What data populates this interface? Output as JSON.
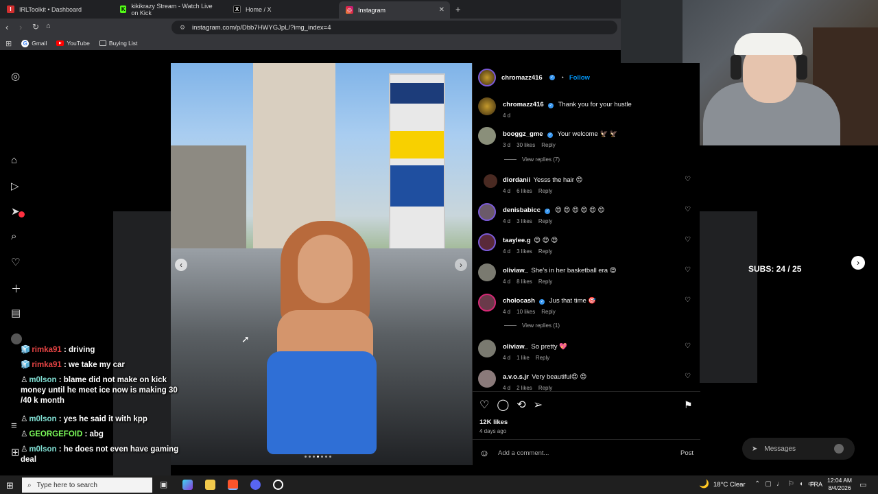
{
  "browser": {
    "tabs": [
      {
        "label": "IRLToolkit • Dashboard",
        "color": "#d32f2f",
        "glyph": "I"
      },
      {
        "label": "kikikrazy Stream - Watch Live on Kick",
        "color": "#53fc18",
        "glyph": "K"
      },
      {
        "label": "Home / X",
        "color": "#000000",
        "glyph": "X"
      },
      {
        "label": "Instagram",
        "color": "#e1306c",
        "glyph": "◎"
      }
    ],
    "new_tab": "+",
    "url": "instagram.com/p/Dbb7HWYGJpL/?img_index=4",
    "bookmarks": [
      {
        "label": "Gmail",
        "icon": "G"
      },
      {
        "label": "YouTube",
        "icon": "▶"
      },
      {
        "label": "Buying List",
        "icon": "▭"
      }
    ]
  },
  "post": {
    "author": "chromazz416",
    "follow_label": "Follow",
    "dot": "•",
    "likes": "12K likes",
    "age": "4 days ago",
    "add_comment_placeholder": "Add a comment...",
    "post_label": "Post",
    "comments": [
      {
        "user": "chromazz416",
        "verified": true,
        "text": "Thank you for your hustle",
        "time": "4 d",
        "likes": "",
        "reply": ""
      },
      {
        "user": "booggz_gme",
        "verified": true,
        "text": "Your welcome 🦅 🦅",
        "time": "3 d",
        "likes": "30 likes",
        "reply": "Reply"
      },
      {
        "user": "diordanii",
        "verified": false,
        "text": "Yesss the hair 😍",
        "time": "4 d",
        "likes": "6 likes",
        "reply": "Reply"
      },
      {
        "user": "denisbabicc",
        "verified": true,
        "text": "😍 😍 😍 😍 😍 😍",
        "time": "4 d",
        "likes": "3 likes",
        "reply": "Reply"
      },
      {
        "user": "taaylee.g",
        "verified": false,
        "text": "😍 😍 😍",
        "time": "4 d",
        "likes": "3 likes",
        "reply": "Reply"
      },
      {
        "user": "oliviaw_",
        "verified": false,
        "text": "She's in her basketball era 😍",
        "time": "4 d",
        "likes": "8 likes",
        "reply": "Reply"
      },
      {
        "user": "cholocash",
        "verified": true,
        "text": "Jus that time 🎯",
        "time": "4 d",
        "likes": "10 likes",
        "reply": "Reply"
      },
      {
        "user": "oliviaw_",
        "verified": false,
        "text": "So pretty 💖",
        "time": "4 d",
        "likes": "1 like",
        "reply": "Reply"
      },
      {
        "user": "a.v.o.s.jr",
        "verified": false,
        "text": "Very beautiful😍 😍",
        "time": "4 d",
        "likes": "2 likes",
        "reply": "Reply"
      }
    ],
    "view_replies_1": "View replies (7)",
    "view_replies_2": "View replies (1)"
  },
  "overlay": {
    "subs": "SUBS: 24 / 25",
    "messages": "Messages",
    "chat": [
      {
        "name": "rimka91",
        "color": "#e94545",
        "text": " : driving"
      },
      {
        "name": "rimka91",
        "color": "#e94545",
        "text": " : we take my car"
      },
      {
        "name": "m0lson",
        "color": "#7fdcd0",
        "text": " : blame did not make on kick money until he meet ice now is making 30 /40 k month"
      },
      {
        "name": "m0lson",
        "color": "#7fdcd0",
        "text": " : yes he said it with kpp"
      },
      {
        "name": "GEORGEFOID",
        "color": "#7cfc5a",
        "text": " : abg"
      },
      {
        "name": "m0lson",
        "color": "#7fdcd0",
        "text": " : he does not even have gaming deal"
      }
    ]
  },
  "taskbar": {
    "search_placeholder": "Type here to search",
    "weather": "18°C  Clear",
    "lang": "FRA",
    "time": "12:04 AM",
    "date": "8/4/2026"
  },
  "colors": {
    "accent": "#0095f6",
    "bg": "#000000"
  }
}
